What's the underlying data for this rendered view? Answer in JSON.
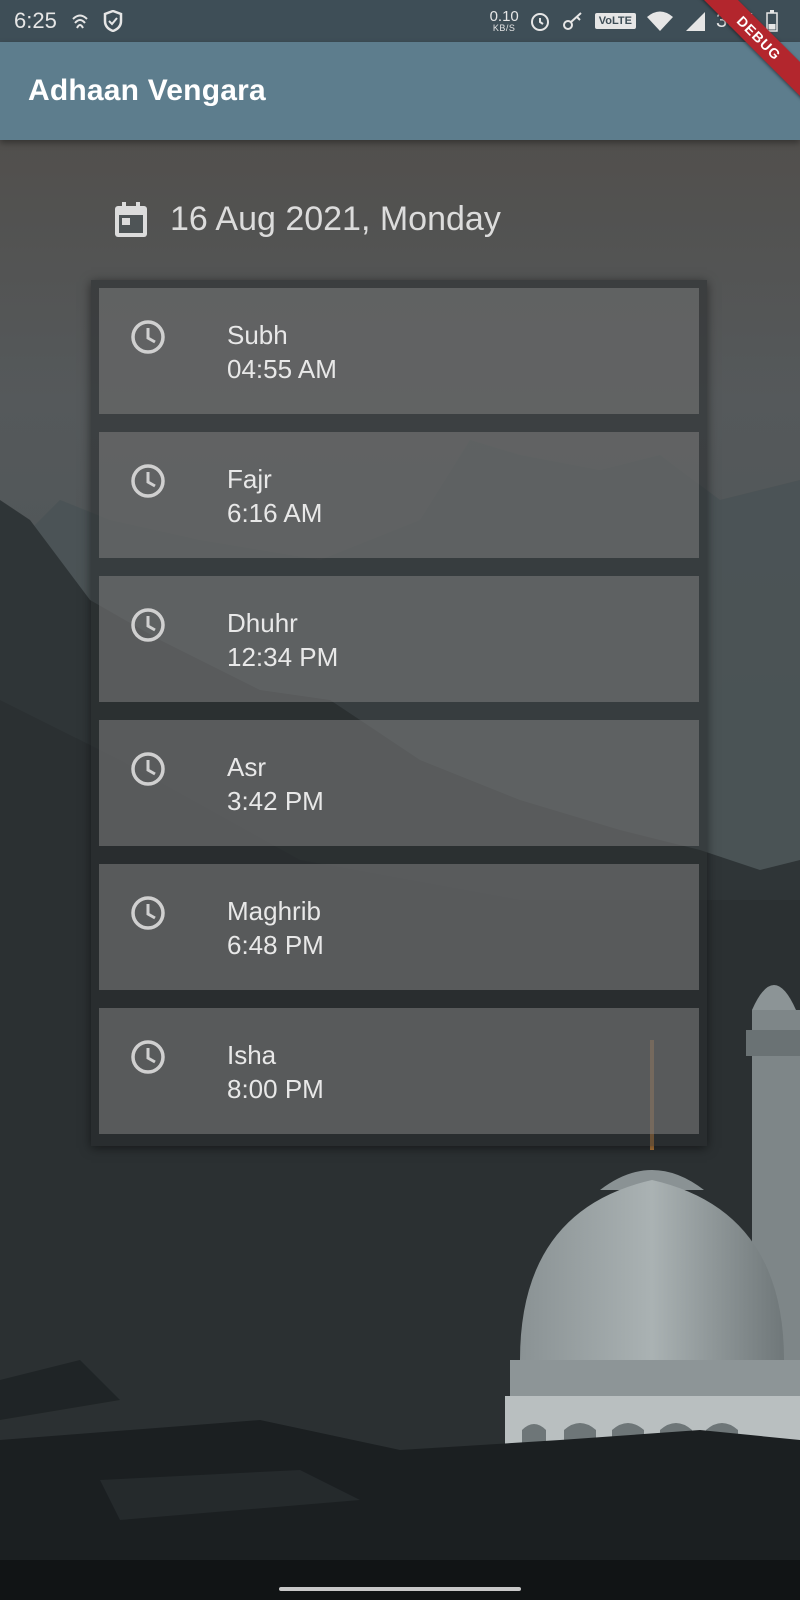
{
  "status_bar": {
    "time": "6:25",
    "net_speed_value": "0.10",
    "net_speed_unit": "KB/S",
    "volte": "VoLTE",
    "battery": "36%"
  },
  "app_bar": {
    "title": "Adhaan Vengara",
    "debug_label": "DEBUG"
  },
  "date": {
    "text": "16 Aug 2021, Monday"
  },
  "prayers": [
    {
      "name": "Subh",
      "time": "04:55 AM"
    },
    {
      "name": "Fajr",
      "time": "6:16 AM"
    },
    {
      "name": "Dhuhr",
      "time": "12:34 PM"
    },
    {
      "name": "Asr",
      "time": "3:42 PM"
    },
    {
      "name": "Maghrib",
      "time": "6:48 PM"
    },
    {
      "name": "Isha",
      "time": "8:00 PM"
    }
  ],
  "icons": {
    "date": "calendar-icon",
    "prayer": "clock-icon"
  }
}
